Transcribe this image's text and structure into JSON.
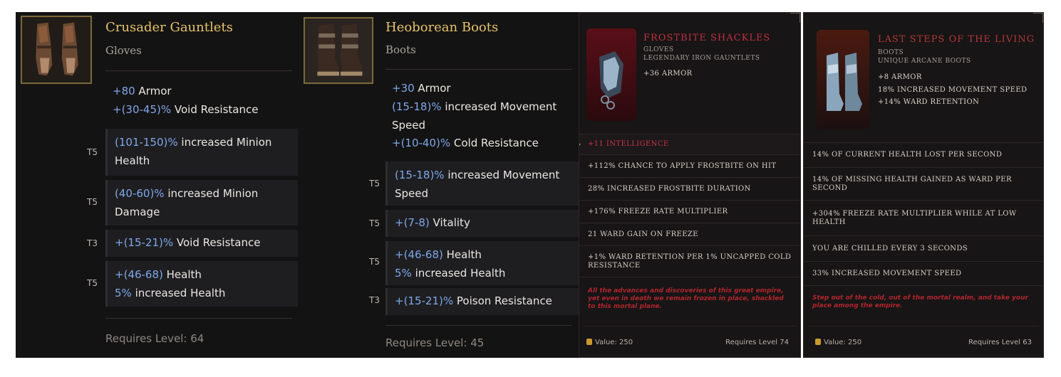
{
  "panel1": {
    "name": "Crusader Gauntlets",
    "type": "Gloves",
    "implicit_1_value": "+80",
    "implicit_1_text": " Armor",
    "implicit_2_value": "+(30-45)%",
    "implicit_2_text": " Void Resistance",
    "affixes": [
      {
        "tier": "T5",
        "value": "(101-150)%",
        "text": " increased Minion Health"
      },
      {
        "tier": "T5",
        "value": "(40-60)%",
        "text": " increased Minion Damage"
      },
      {
        "tier": "T3",
        "value": "+(15-21)%",
        "text": " Void Resistance"
      },
      {
        "tier": "T5",
        "value": "+(46-68)",
        "text": " Health",
        "value2": "5%",
        "text2": " increased Health"
      }
    ],
    "requires": "Requires Level: 64"
  },
  "panel2": {
    "name": "Heoborean Boots",
    "type": "Boots",
    "implicit_1_value": "+30",
    "implicit_1_text": " Armor",
    "implicit_2_value": "(15-18)%",
    "implicit_2_text": " increased Movement Speed",
    "implicit_3_value": "+(10-40)%",
    "implicit_3_text": " Cold Resistance",
    "affixes": [
      {
        "tier": "T5",
        "value": "(15-18)%",
        "text": " increased Movement Speed"
      },
      {
        "tier": "T5",
        "value": "+(7-8)",
        "text": " Vitality"
      },
      {
        "tier": "T5",
        "value": "+(46-68)",
        "text": " Health",
        "value2": "5%",
        "text2": " increased Health"
      },
      {
        "tier": "T3",
        "value": "+(15-21)%",
        "text": " Poison Resistance"
      }
    ],
    "requires": "Requires Level: 45"
  },
  "panel3": {
    "name": "Frostbite Shackles",
    "sub1": "Gloves",
    "sub2": "Legendary Iron Gauntlets",
    "stats": [
      "+36 Armor"
    ],
    "mods": [
      "+11 Intelligence",
      "+112% Chance to apply Frostbite on Hit",
      "28% Increased Frostbite Duration",
      "+176% Freeze Rate Multiplier",
      "21 Ward Gain on Freeze",
      "+1% Ward Retention per 1% uncapped Cold Resistance"
    ],
    "lore": "All the advances and discoveries of this great empire, yet even in death we remain frozen in place, shackled to this mortal plane.",
    "value": "Value: 250",
    "requires": "Requires Level 74"
  },
  "panel4": {
    "name": "Last Steps of the Living",
    "sub1": "Boots",
    "sub2": "Unique Arcane Boots",
    "stats": [
      "+8 Armor",
      "18% increased Movement Speed",
      "+14% Ward Retention"
    ],
    "mods": [
      "14% of Current Health Lost per second",
      "14% of Missing Health gained as Ward per second",
      "+304% Freeze Rate Multiplier while at Low Health",
      "You are Chilled every 3 seconds",
      "33% increased Movement Speed"
    ],
    "lore": "Step out of the cold, out of the mortal realm, and take your place among the empire.",
    "value": "Value: 250",
    "requires": "Requires Level 63"
  },
  "colors": {
    "legendary_name": "#c0303f",
    "rare_name": "#e7c46d",
    "range_blue": "#7fa8e8",
    "lore_red": "#b0252f"
  },
  "icons": [
    "gauntlets-item-icon",
    "boots-item-icon",
    "shackles-item-icon",
    "unique-boots-item-icon",
    "gold-coin-icon"
  ]
}
